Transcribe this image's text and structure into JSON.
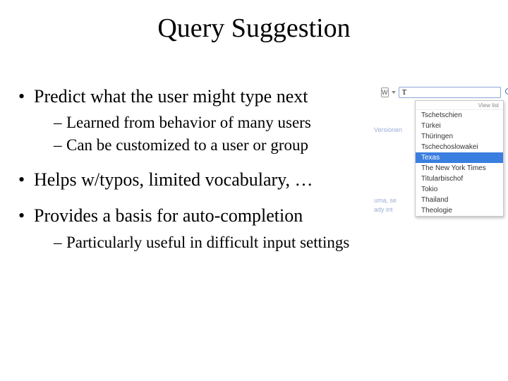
{
  "title": "Query Suggestion",
  "bullets": {
    "b1": "Predict what the user might type next",
    "b1_sub": {
      "s1": "Learned from behavior of many users",
      "s2": "Can be customized to a user or group"
    },
    "b2": "Helps w/typos, limited vocabulary, …",
    "b3": "Provides a basis for auto-completion",
    "b3_sub": {
      "s1": "Particularly useful in difficult input settings"
    }
  },
  "widget": {
    "source_glyph": "W",
    "input_value": "T",
    "dropdown_header": "View list",
    "bg_words": [
      "Versionen",
      "uma, se",
      "ady int"
    ],
    "suggestions": [
      {
        "text": "Tschetschien",
        "selected": false
      },
      {
        "text": "Türkei",
        "selected": false
      },
      {
        "text": "Thüringen",
        "selected": false
      },
      {
        "text": "Tschechoslowakei",
        "selected": false
      },
      {
        "text": "Texas",
        "selected": true
      },
      {
        "text": "The New York Times",
        "selected": false
      },
      {
        "text": "Titularbischof",
        "selected": false
      },
      {
        "text": "Tokio",
        "selected": false
      },
      {
        "text": "Thailand",
        "selected": false
      },
      {
        "text": "Theologie",
        "selected": false
      }
    ]
  }
}
